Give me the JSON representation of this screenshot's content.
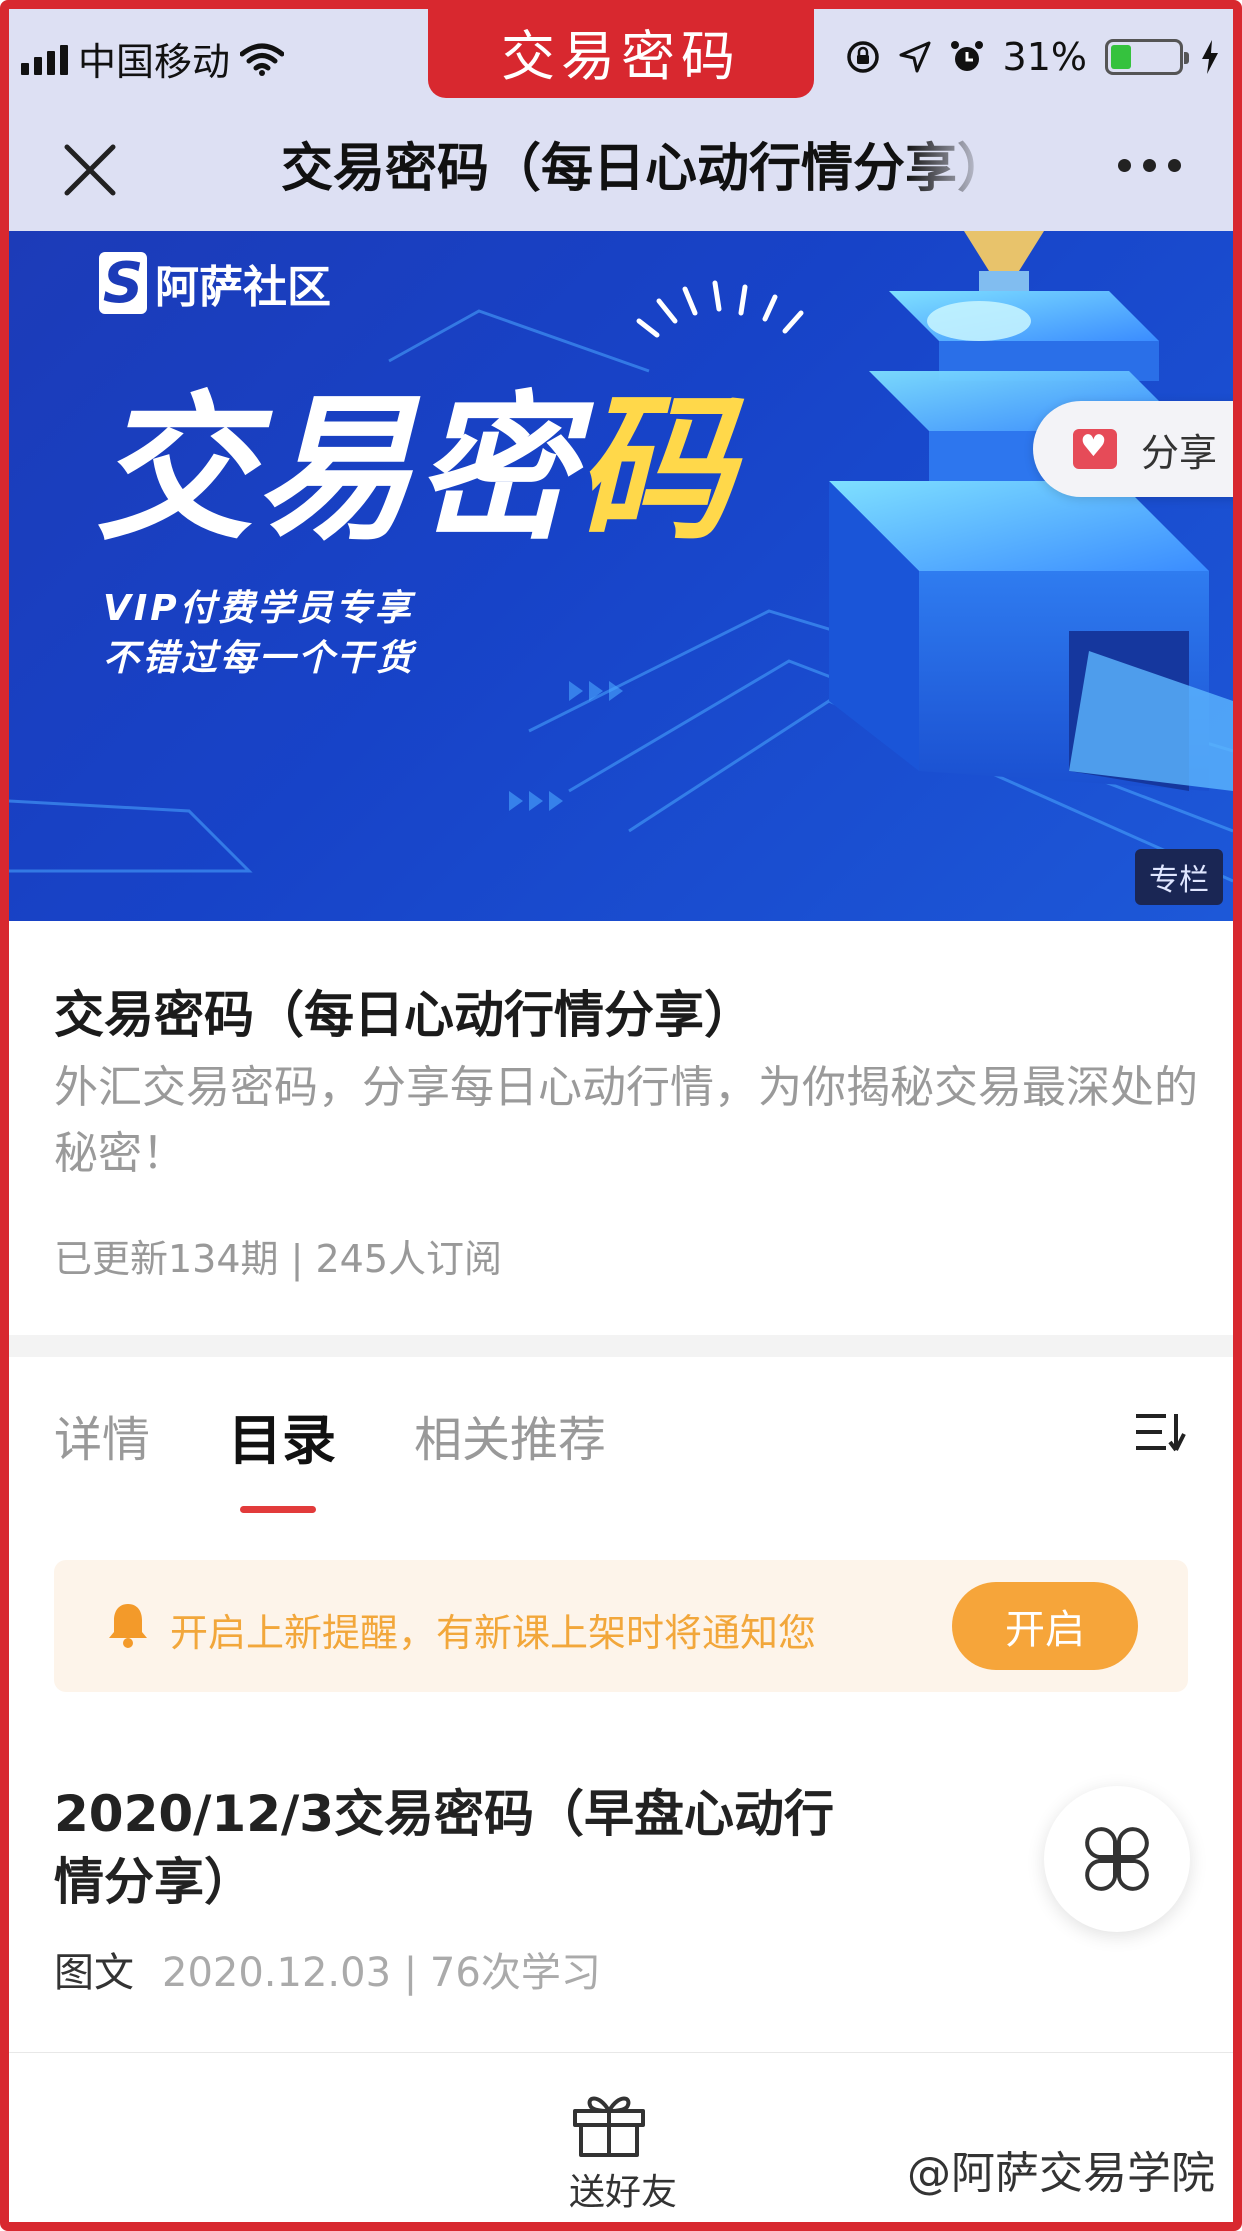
{
  "status_bar": {
    "carrier": "中国移动",
    "battery_text": "31%",
    "battery_level": 0.31
  },
  "page_tab": "交易密码",
  "nav": {
    "title": "交易密码（每日心动行情分享）"
  },
  "banner": {
    "brand": "阿萨社区",
    "title_white": "交易密码",
    "title_white_part": "交易密",
    "title_yellow_part": "码",
    "subtitle_line1": "VIP付费学员专享",
    "subtitle_line2": "不错过每一个干货",
    "share_label": "分享",
    "column_tag": "专栏"
  },
  "course": {
    "title": "交易密码（每日心动行情分享）",
    "description": "外汇交易密码，分享每日心动行情，为你揭秘交易最深处的秘密！",
    "meta": "已更新134期 | 245人订阅"
  },
  "tabs": [
    {
      "label": "详情",
      "active": false
    },
    {
      "label": "目录",
      "active": true
    },
    {
      "label": "相关推荐",
      "active": false
    }
  ],
  "notice": {
    "text": "开启上新提醒，有新课上架时将通知您",
    "button": "开启"
  },
  "lesson": {
    "title": "2020/12/3交易密码（早盘心动行情分享）",
    "kind": "图文",
    "meta": "2020.12.03 | 76次学习"
  },
  "bottom": {
    "gift_label": "送好友",
    "watermark": "@阿萨交易学院"
  },
  "colors": {
    "accent_red": "#d8282f",
    "notice_orange": "#f6a53a",
    "banner_blue": "#1743c8",
    "title_yellow": "#ffd84a"
  }
}
